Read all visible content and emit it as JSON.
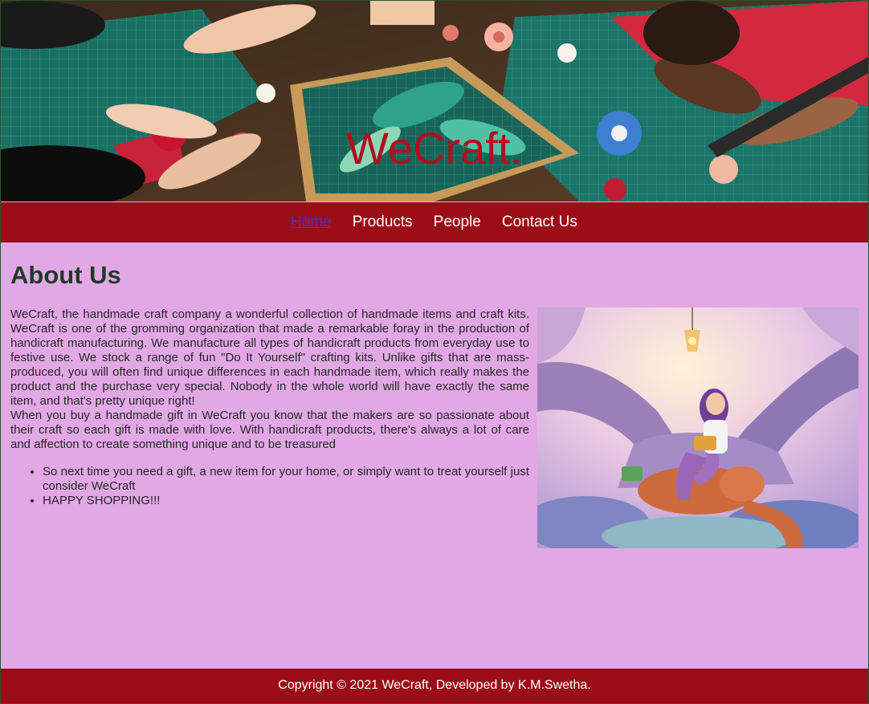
{
  "header": {
    "brand": "WeCraft."
  },
  "nav": {
    "items": [
      {
        "label": "Home",
        "active": true
      },
      {
        "label": "Products",
        "active": false
      },
      {
        "label": "People",
        "active": false
      },
      {
        "label": "Contact Us",
        "active": false
      }
    ]
  },
  "about": {
    "title": "About Us",
    "paragraph1": "WeCraft, the handmade craft company a wonderful collection of handmade items and craft kits. WeCraft is one of the gromming organization that made a remarkable foray in the production of handicraft manufacturing. We manufacture all types of handicraft products from everyday use to festive use. We stock a range of fun \"Do It Yourself\" crafting kits. Unlike gifts that are mass-produced, you will often find unique differences in each handmade item, which really makes the product and the purchase very special. Nobody in the whole world will have exactly the same item, and that's pretty unique right!",
    "paragraph2": "When you buy a handmade gift in WeCraft you know that the makers are so passionate about their craft so each gift is made with love. With handicraft products, there's always a lot of care and affection to create something unique and to be treasured",
    "bullets": [
      "So next time you need a gift, a new item for your home, or simply want to treat yourself just consider WeCraft",
      "HAPPY SHOPPING!!!"
    ]
  },
  "footer": {
    "copyright": "Copyright © 2021 WeCraft, Developed by K.M.Swetha."
  },
  "colors": {
    "nav_bg": "#9b0e18",
    "page_bg": "#e2a8e6",
    "brand_text": "#b40c1e",
    "active_link": "#5b2bb8",
    "heading": "#1e3b29"
  }
}
